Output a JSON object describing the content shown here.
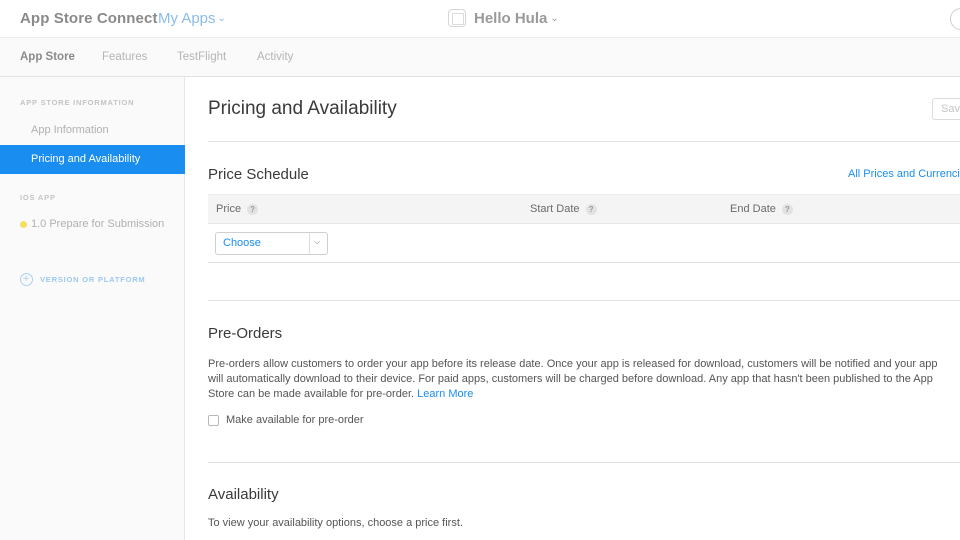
{
  "header": {
    "brand": "App Store Connect",
    "my_apps": "My Apps",
    "app_name": "Hello Hula"
  },
  "tabs": [
    {
      "label": "App Store",
      "active": true
    },
    {
      "label": "Features",
      "active": false
    },
    {
      "label": "TestFlight",
      "active": false
    },
    {
      "label": "Activity",
      "active": false
    }
  ],
  "sidebar": {
    "section_info": "APP STORE INFORMATION",
    "items": [
      {
        "label": "App Information",
        "active": false
      },
      {
        "label": "Pricing and Availability",
        "active": true
      }
    ],
    "section_ios": "IOS APP",
    "version_item": "1.0 Prepare for Submission",
    "version_status_color": "#f5df62",
    "add_platform": "VERSION OR PLATFORM"
  },
  "main": {
    "title": "Pricing and Availability",
    "save_label": "Save",
    "price_schedule": {
      "title": "Price Schedule",
      "all_prices_link": "All Prices and Currencies",
      "columns": [
        "Price",
        "Start Date",
        "End Date"
      ],
      "help_icon": "?",
      "price_select_value": "Choose"
    },
    "pre_orders": {
      "title": "Pre-Orders",
      "description_line1": "Pre-orders allow customers to order your app before its release date. Once your app is released for download, customers will be notified and your app",
      "description_line2": "will automatically download to their device. For paid apps, customers will be charged before download. Any app that hasn't been published to the App",
      "description_line3": "Store can be made available for pre-order.",
      "learn_more": "Learn More",
      "checkbox_label": "Make available for pre-order",
      "checkbox_checked": false
    },
    "availability": {
      "title": "Availability",
      "text": "To view your availability options, choose a price first."
    }
  },
  "colors": {
    "accent": "#1a8ef0",
    "sidebar_active_bg": "#1a8ef0"
  }
}
